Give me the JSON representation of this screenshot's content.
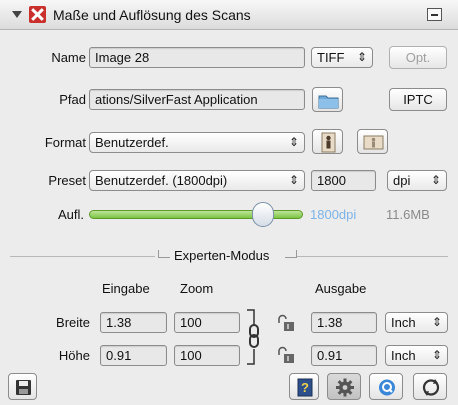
{
  "panel": {
    "title": "Maße und Auflösung des Scans",
    "accent_color": "#c9302c"
  },
  "name_row": {
    "label": "Name",
    "value": "Image 28",
    "format_value": "TIFF",
    "opt_label": "Opt."
  },
  "path_row": {
    "label": "Pfad",
    "value": "ations/SilverFast Application",
    "iptc_label": "IPTC"
  },
  "format_row": {
    "label": "Format",
    "value": "Benutzerdef."
  },
  "preset_row": {
    "label": "Preset",
    "value": "Benutzerdef. (1800dpi)",
    "dpi_value": "1800",
    "unit_value": "dpi"
  },
  "resolution_row": {
    "label": "Aufl.",
    "display": "1800dpi",
    "filesize": "11.6MB",
    "slider_fraction": 0.82,
    "slider_color": "#7cc543"
  },
  "expert": {
    "title": "Experten-Modus",
    "col_input": "Eingabe",
    "col_zoom": "Zoom",
    "col_output": "Ausgabe",
    "rows": [
      {
        "label": "Breite",
        "input": "1.38",
        "zoom": "100",
        "output": "1.38",
        "unit": "Inch"
      },
      {
        "label": "Höhe",
        "input": "0.91",
        "zoom": "100",
        "output": "0.91",
        "unit": "Inch"
      }
    ]
  },
  "icons": {
    "collapse": "collapse-icon",
    "save": "floppy-disk-icon",
    "help": "help-icon",
    "settings": "gear-icon",
    "info": "q-icon",
    "reset": "reset-icon"
  }
}
